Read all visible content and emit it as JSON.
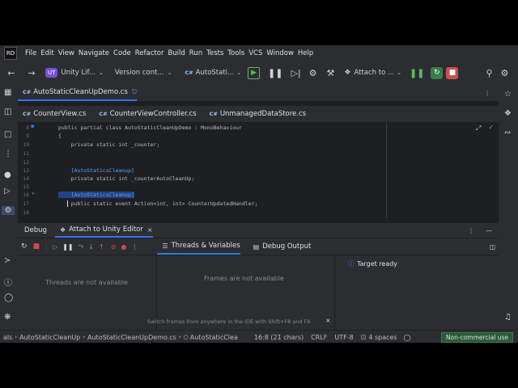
{
  "menu": [
    "File",
    "Edit",
    "View",
    "Navigate",
    "Code",
    "Refactor",
    "Build",
    "Run",
    "Tests",
    "Tools",
    "VCS",
    "Window",
    "Help"
  ],
  "logo": "RD",
  "toolbar": {
    "project_badge": "UT",
    "project_name": "Unity Lif...",
    "version_control": "Version cont...",
    "run_config": "AutoStati...",
    "attach": "Attach to ..."
  },
  "editor_tab_top": "AutoStaticCleanUpDemo.cs",
  "cs_badge": "C#",
  "editor_tabs": [
    "CounterView.cs",
    "CounterViewController.cs",
    "UnmanagedDataStore.cs"
  ],
  "code_lines": [
    {
      "n": "8",
      "text": "public partial class AutoStaticCleanUpDemo : MonoBehaviour"
    },
    {
      "n": "9",
      "text": "{"
    },
    {
      "n": "10",
      "text": "    private static int _counter;"
    },
    {
      "n": "11",
      "text": ""
    },
    {
      "n": "12",
      "text": ""
    },
    {
      "n": "13",
      "text": "    [AutoStaticsCleanup]"
    },
    {
      "n": "14",
      "text": "    private static int _counterAutoCleanUp;"
    },
    {
      "n": "15",
      "text": ""
    },
    {
      "n": "16",
      "text": "    [AutoStaticsCleanup]"
    },
    {
      "n": "17",
      "text": "    public static event Action<int, int> CounterUpdatedHandler;"
    },
    {
      "n": "18",
      "text": ""
    }
  ],
  "debug": {
    "title": "Debug",
    "tab": "Attach to Unity Editor",
    "threads_tab": "Threads & Variables",
    "output_tab": "Debug Output",
    "threads_empty": "Threads are not available",
    "frames_empty": "Frames are not available",
    "target": "Target ready",
    "hint": "Switch frames from anywhere in the IDE with Shift+F8 and F8"
  },
  "status": {
    "crumb1": "als",
    "crumb2": "AutoStaticCleanUp",
    "crumb3": "AutoStaticCleanUpDemo.cs",
    "crumb4": "AutoStaticClea",
    "position": "16:8 (21 chars)",
    "line_sep": "CRLF",
    "encoding": "UTF-8",
    "indent": "4 spaces",
    "license": "Non-commercial use"
  }
}
